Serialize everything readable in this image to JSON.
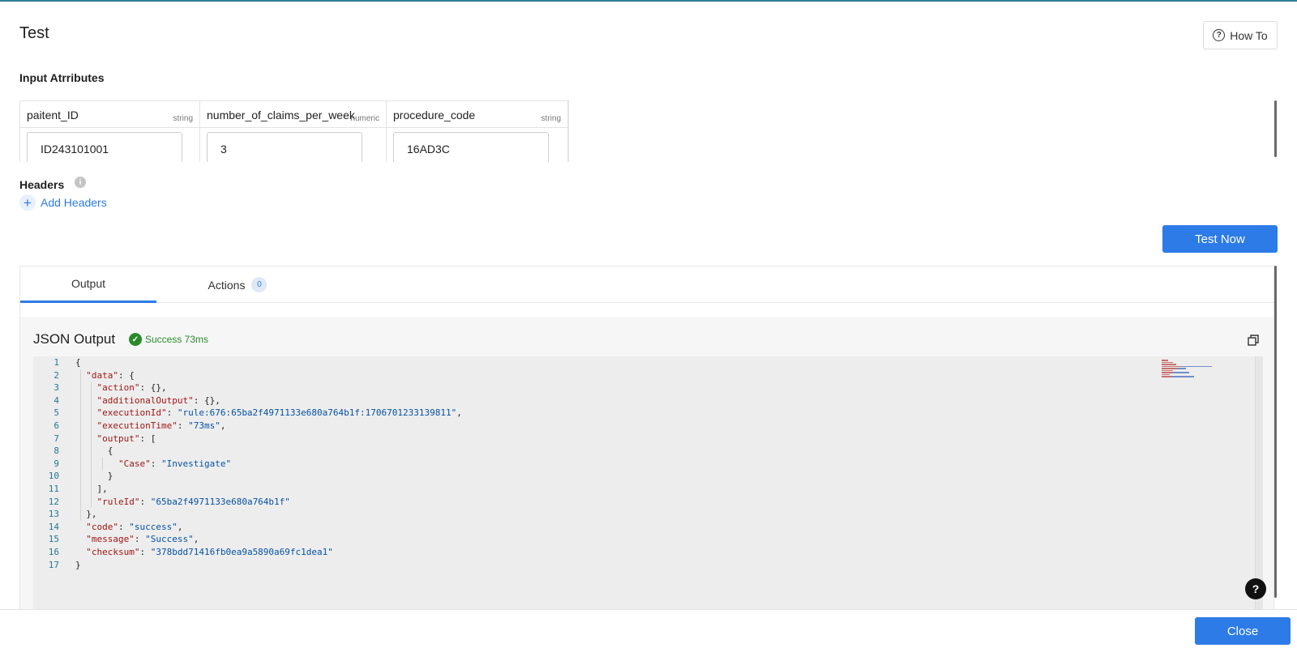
{
  "header": {
    "title": "Test",
    "how_to_label": "How To"
  },
  "input_attributes": {
    "label": "Input Atrributes",
    "columns": [
      {
        "name": "paitent_ID",
        "type": "string",
        "value": "ID243101001"
      },
      {
        "name": "number_of_claims_per_week",
        "type": "numeric",
        "value": "3"
      },
      {
        "name": "procedure_code",
        "type": "string",
        "value": "16AD3C"
      }
    ]
  },
  "headers": {
    "label": "Headers",
    "add_label": "Add Headers"
  },
  "test_now_label": "Test Now",
  "tabs": {
    "output_label": "Output",
    "actions_label": "Actions",
    "actions_count": "0"
  },
  "json_output": {
    "title": "JSON Output",
    "status": "Success 73ms"
  },
  "code_lines": [
    {
      "num": "1",
      "parts": [
        {
          "t": "p",
          "v": "{"
        }
      ]
    },
    {
      "num": "2",
      "parts": [
        {
          "t": "p",
          "v": "  "
        },
        {
          "t": "k",
          "v": "\"data\""
        },
        {
          "t": "p",
          "v": ": {"
        }
      ]
    },
    {
      "num": "3",
      "parts": [
        {
          "t": "p",
          "v": "    "
        },
        {
          "t": "k",
          "v": "\"action\""
        },
        {
          "t": "p",
          "v": ": {},"
        }
      ]
    },
    {
      "num": "4",
      "parts": [
        {
          "t": "p",
          "v": "    "
        },
        {
          "t": "k",
          "v": "\"additionalOutput\""
        },
        {
          "t": "p",
          "v": ": {},"
        }
      ]
    },
    {
      "num": "5",
      "parts": [
        {
          "t": "p",
          "v": "    "
        },
        {
          "t": "k",
          "v": "\"executionId\""
        },
        {
          "t": "p",
          "v": ": "
        },
        {
          "t": "s",
          "v": "\"rule:676:65ba2f4971133e680a764b1f:1706701233139811\""
        },
        {
          "t": "p",
          "v": ","
        }
      ]
    },
    {
      "num": "6",
      "parts": [
        {
          "t": "p",
          "v": "    "
        },
        {
          "t": "k",
          "v": "\"executionTime\""
        },
        {
          "t": "p",
          "v": ": "
        },
        {
          "t": "s",
          "v": "\"73ms\""
        },
        {
          "t": "p",
          "v": ","
        }
      ]
    },
    {
      "num": "7",
      "parts": [
        {
          "t": "p",
          "v": "    "
        },
        {
          "t": "k",
          "v": "\"output\""
        },
        {
          "t": "p",
          "v": ": ["
        }
      ]
    },
    {
      "num": "8",
      "parts": [
        {
          "t": "p",
          "v": "      {"
        }
      ]
    },
    {
      "num": "9",
      "parts": [
        {
          "t": "p",
          "v": "        "
        },
        {
          "t": "k",
          "v": "\"Case\""
        },
        {
          "t": "p",
          "v": ": "
        },
        {
          "t": "s",
          "v": "\"Investigate\""
        }
      ]
    },
    {
      "num": "10",
      "parts": [
        {
          "t": "p",
          "v": "      }"
        }
      ]
    },
    {
      "num": "11",
      "parts": [
        {
          "t": "p",
          "v": "    ],"
        }
      ]
    },
    {
      "num": "12",
      "parts": [
        {
          "t": "p",
          "v": "    "
        },
        {
          "t": "k",
          "v": "\"ruleId\""
        },
        {
          "t": "p",
          "v": ": "
        },
        {
          "t": "s",
          "v": "\"65ba2f4971133e680a764b1f\""
        }
      ]
    },
    {
      "num": "13",
      "parts": [
        {
          "t": "p",
          "v": "  },"
        }
      ]
    },
    {
      "num": "14",
      "parts": [
        {
          "t": "p",
          "v": "  "
        },
        {
          "t": "k",
          "v": "\"code\""
        },
        {
          "t": "p",
          "v": ": "
        },
        {
          "t": "s",
          "v": "\"success\""
        },
        {
          "t": "p",
          "v": ","
        }
      ]
    },
    {
      "num": "15",
      "parts": [
        {
          "t": "p",
          "v": "  "
        },
        {
          "t": "k",
          "v": "\"message\""
        },
        {
          "t": "p",
          "v": ": "
        },
        {
          "t": "s",
          "v": "\"Success\""
        },
        {
          "t": "p",
          "v": ","
        }
      ]
    },
    {
      "num": "16",
      "parts": [
        {
          "t": "p",
          "v": "  "
        },
        {
          "t": "k",
          "v": "\"checksum\""
        },
        {
          "t": "p",
          "v": ": "
        },
        {
          "t": "s",
          "v": "\"378bdd71416fb0ea9a5890a69fc1dea1\""
        }
      ]
    },
    {
      "num": "17",
      "parts": [
        {
          "t": "p",
          "v": "}"
        }
      ]
    }
  ],
  "help_label": "?",
  "close_label": "Close",
  "colors": {
    "accent": "#2d7be6",
    "success": "#2a8a2a",
    "json_key": "#a31515",
    "json_string": "#0451a5"
  }
}
